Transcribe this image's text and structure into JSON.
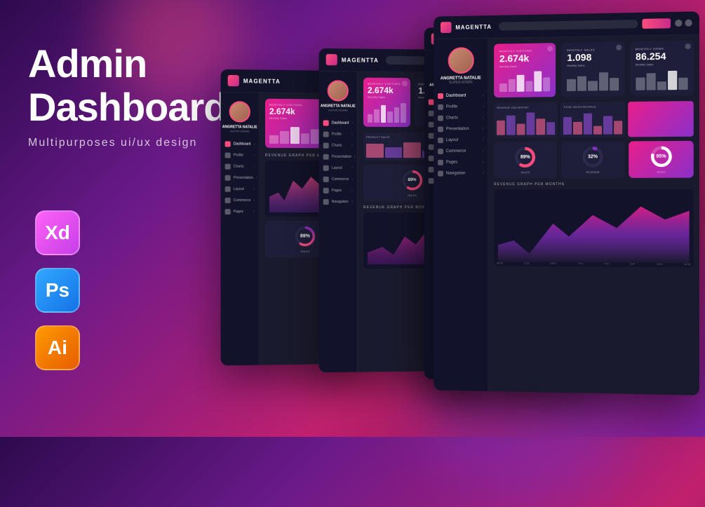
{
  "title": {
    "line1": "Admin",
    "line2": "Dashboard",
    "subtitle": "Multipurposes ui/ux design"
  },
  "tools": [
    {
      "name": "Xd",
      "label": "Adobe XD",
      "color_class": "tool-icon-xd"
    },
    {
      "name": "Ps",
      "label": "Adobe Photoshop",
      "color_class": "tool-icon-ps"
    },
    {
      "name": "Ai",
      "label": "Adobe Illustrator",
      "color_class": "tool-icon-ai"
    }
  ],
  "brand": "MAGENTTA",
  "nav_items": [
    {
      "label": "Dashboard",
      "active": true
    },
    {
      "label": "Profile"
    },
    {
      "label": "Charts"
    },
    {
      "label": "Presentation"
    },
    {
      "label": "Layout"
    },
    {
      "label": "Commerce"
    },
    {
      "label": "Pages"
    },
    {
      "label": "Navigation"
    }
  ],
  "stats": [
    {
      "label": "MONTHLY VISITORS",
      "value": "2.674k",
      "sub": "Monthly Sales"
    },
    {
      "label": "MONTHLY SALES",
      "value": "1.098",
      "sub": "Monthly Sales"
    },
    {
      "label": "MONTHLY VIEWS",
      "value": "86.254",
      "sub": "Monthly Sales"
    }
  ],
  "donuts": [
    {
      "value": "89%",
      "sub": "SALES"
    },
    {
      "value": "32%",
      "sub": "REVENUE"
    },
    {
      "value": "95%",
      "sub": "INDEX"
    }
  ],
  "graph_section": "REVENUE GRAPH PER MONTHS",
  "x_labels": [
    "MON",
    "TUE",
    "WED",
    "THU",
    "FRI",
    "SAT",
    "SUN",
    "MON"
  ],
  "user": {
    "name": "ANGRETTA NATALIE",
    "role": "SUPER ADMIN"
  }
}
